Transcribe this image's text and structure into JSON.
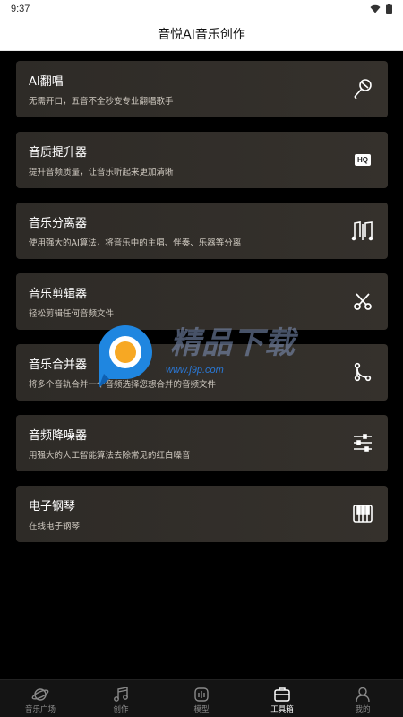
{
  "status": {
    "time": "9:37"
  },
  "header": {
    "title": "音悦AI音乐创作"
  },
  "tools": [
    {
      "title": "AI翻唱",
      "desc": "无需开口，五音不全秒变专业翻唱歌手",
      "icon": "microphone-icon"
    },
    {
      "title": "音质提升器",
      "desc": "提升音频质量，让音乐听起来更加清晰",
      "icon": "hq-icon"
    },
    {
      "title": "音乐分离器",
      "desc": "使用强大的AI算法，将音乐中的主唱、伴奏、乐器等分离",
      "icon": "music-split-icon"
    },
    {
      "title": "音乐剪辑器",
      "desc": "轻松剪辑任何音频文件",
      "icon": "scissors-icon"
    },
    {
      "title": "音乐合并器",
      "desc": "将多个音轨合并一个音频选择您想合并的音频文件",
      "icon": "merge-icon"
    },
    {
      "title": "音频降噪器",
      "desc": "用强大的人工智能算法去除常见的红白噪音",
      "icon": "sliders-icon"
    },
    {
      "title": "电子钢琴",
      "desc": "在线电子钢琴",
      "icon": "piano-icon"
    }
  ],
  "hq_label": "HQ",
  "tabs": [
    {
      "label": "音乐广场",
      "icon": "planet-icon",
      "active": false
    },
    {
      "label": "创作",
      "icon": "music-note-icon",
      "active": false
    },
    {
      "label": "模型",
      "icon": "model-icon",
      "active": false
    },
    {
      "label": "工具箱",
      "icon": "toolbox-icon",
      "active": true
    },
    {
      "label": "我的",
      "icon": "person-icon",
      "active": false
    }
  ],
  "watermark": {
    "text": "精品下载",
    "url": "www.j9p.com"
  }
}
